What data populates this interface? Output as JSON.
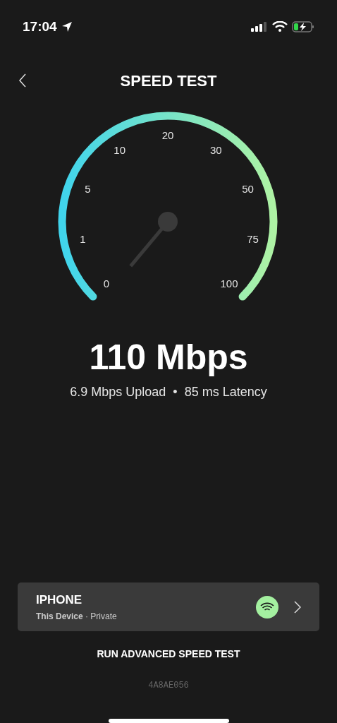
{
  "status_bar": {
    "time": "17:04"
  },
  "header": {
    "title": "SPEED TEST"
  },
  "gauge": {
    "ticks": [
      "0",
      "1",
      "5",
      "10",
      "20",
      "30",
      "50",
      "75",
      "100"
    ]
  },
  "result": {
    "download": "110 Mbps",
    "upload": "6.9 Mbps Upload",
    "separator": "•",
    "latency": "85 ms Latency"
  },
  "device": {
    "name": "IPHONE",
    "subtitle": "**This Device** · Private"
  },
  "advanced_button": "RUN ADVANCED SPEED TEST",
  "code": "4A8AE056"
}
